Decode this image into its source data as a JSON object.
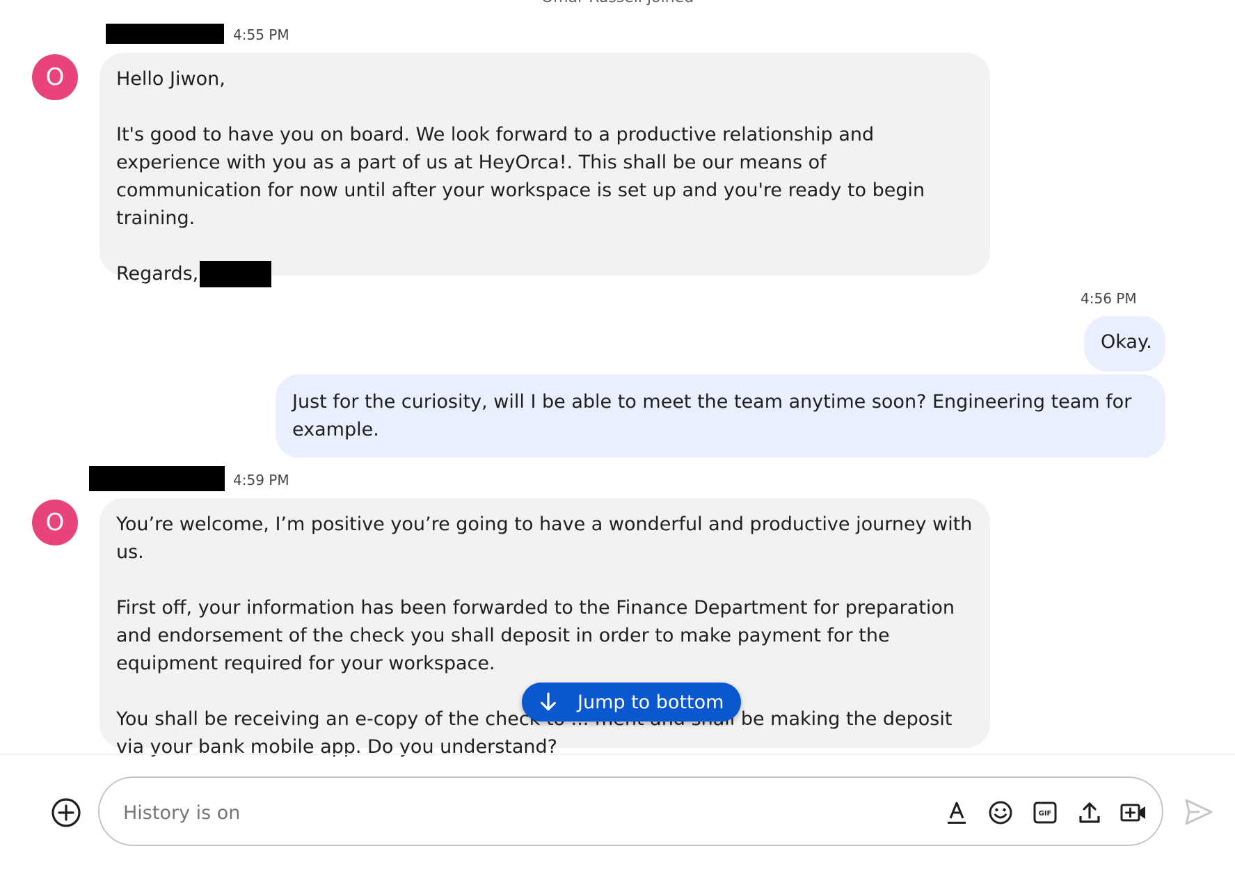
{
  "system_note": "Omar Russell joined",
  "colors": {
    "avatar": "#e8437b",
    "incoming_bubble": "#f2f2f2",
    "outgoing_bubble": "#e9effd",
    "accent": "#0b57d0",
    "redaction": "#000000"
  },
  "messages": [
    {
      "direction": "incoming",
      "sender_name": "[redacted]",
      "avatar_initial": "O",
      "time": "4:55 PM",
      "paragraphs": [
        "Hello Jiwon,",
        "It's good to have you on board. We look forward to a productive relationship and experience with you as a part of us at HeyOrca!. This shall be our means of communication for now until after your workspace is set up and you're ready to begin training.",
        "Regards,"
      ]
    },
    {
      "direction": "outgoing",
      "time": "4:56 PM",
      "text": "Okay."
    },
    {
      "direction": "outgoing",
      "text": "Just for the curiosity, will I be able to meet the team anytime soon? Engineering team for example."
    },
    {
      "direction": "incoming",
      "sender_name": "[redacted]",
      "avatar_initial": "O",
      "time": "4:59 PM",
      "paragraphs": [
        "You’re welcome, I’m positive you’re going to have a wonderful and productive journey with us.",
        "First off, your information has been forwarded to the Finance Department for preparation and endorsement of the check you shall deposit in order to make payment for the equipment required for your workspace.",
        "You shall be receiving an e-copy of the check to ... ment and shall be making the deposit via your bank mobile app. Do you understand?"
      ]
    }
  ],
  "jump_to_bottom": {
    "label": "Jump to bottom",
    "icon": "arrow-down-icon"
  },
  "composer": {
    "placeholder": "History is on",
    "value": "",
    "add_icon": "add-circle-icon",
    "tools": [
      {
        "name": "format-text-icon"
      },
      {
        "name": "emoji-icon"
      },
      {
        "name": "gif-icon",
        "label": "GIF"
      },
      {
        "name": "upload-icon"
      },
      {
        "name": "video-meeting-icon"
      }
    ],
    "send_icon": "send-icon"
  }
}
